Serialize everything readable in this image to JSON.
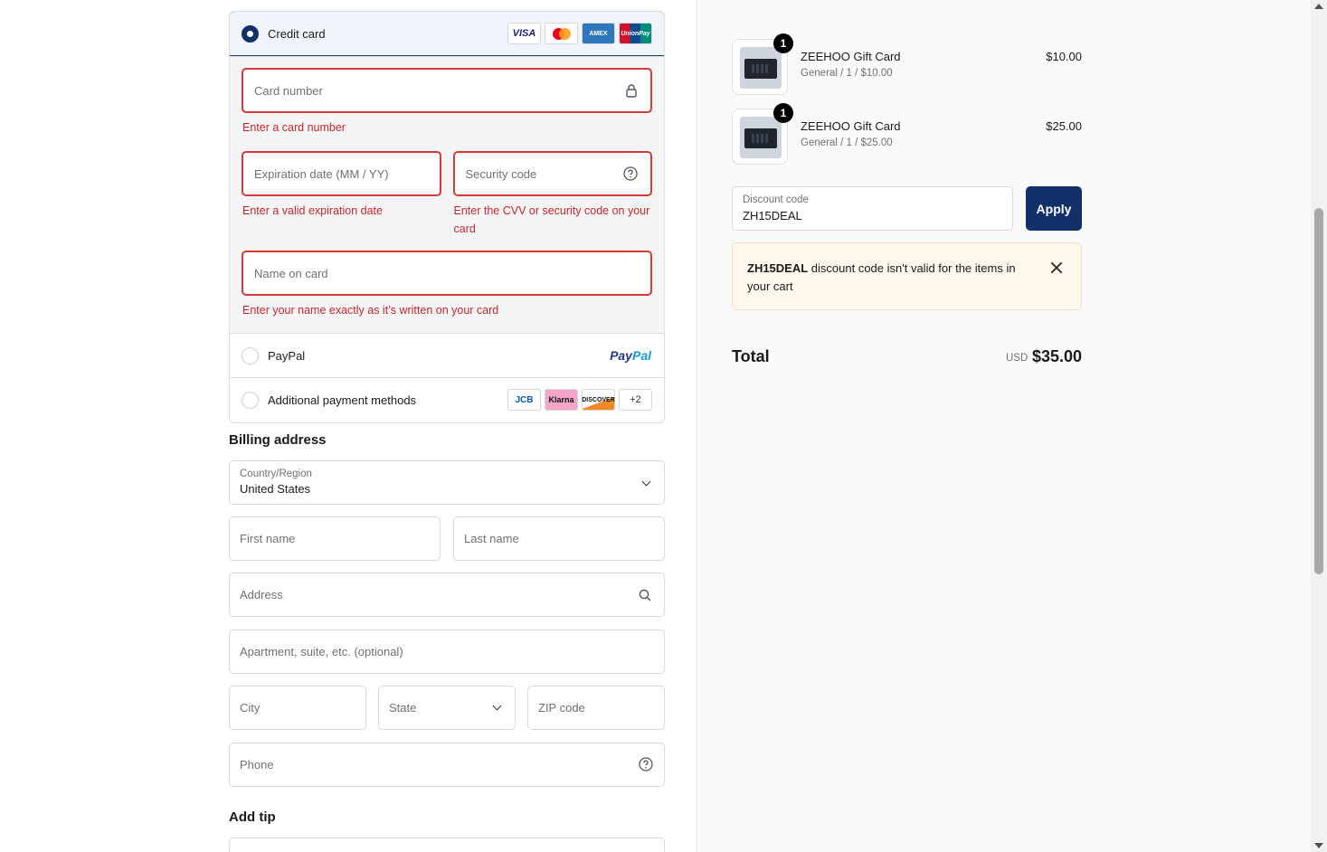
{
  "payment": {
    "credit_card_label": "Credit card",
    "card_badges": [
      "VISA",
      "mastercard",
      "AMEX",
      "UnionPay"
    ],
    "card_number_placeholder": "Card number",
    "card_number_error": "Enter a card number",
    "expiration_placeholder": "Expiration date (MM / YY)",
    "expiration_error": "Enter a valid expiration date",
    "security_placeholder": "Security code",
    "security_error": "Enter the CVV or security code on your card",
    "name_placeholder": "Name on card",
    "name_error": "Enter your name exactly as it’s written on your card",
    "paypal_label": "PayPal",
    "paypal_logo_a": "Pay",
    "paypal_logo_b": "Pal",
    "additional_label": "Additional payment methods",
    "additional_badges": [
      "JCB",
      "Klarna",
      "DISCOVER"
    ],
    "additional_more": "+2",
    "accent": "#13306b",
    "error_color": "#d33b3b"
  },
  "billing": {
    "title": "Billing address",
    "country_label": "Country/Region",
    "country_value": "United States",
    "first_name": "First name",
    "last_name": "Last name",
    "address": "Address",
    "apartment": "Apartment, suite, etc. (optional)",
    "city": "City",
    "state": "State",
    "zip": "ZIP code",
    "phone": "Phone"
  },
  "tip": {
    "title": "Add tip"
  },
  "cart": {
    "items": [
      {
        "name": "ZEEHOO Gift Card",
        "variant": "General / 1 / $10.00",
        "price": "$10.00",
        "qty": "1"
      },
      {
        "name": "ZEEHOO Gift Card",
        "variant": "General / 1 / $25.00",
        "price": "$25.00",
        "qty": "1"
      }
    ],
    "discount_label": "Discount code",
    "discount_value": "ZH15DEAL",
    "apply_label": "Apply",
    "alert_code": "ZH15DEAL",
    "alert_text": " discount code isn't valid for the items in your cart",
    "total_label": "Total",
    "currency": "USD",
    "total": "$35.00"
  }
}
